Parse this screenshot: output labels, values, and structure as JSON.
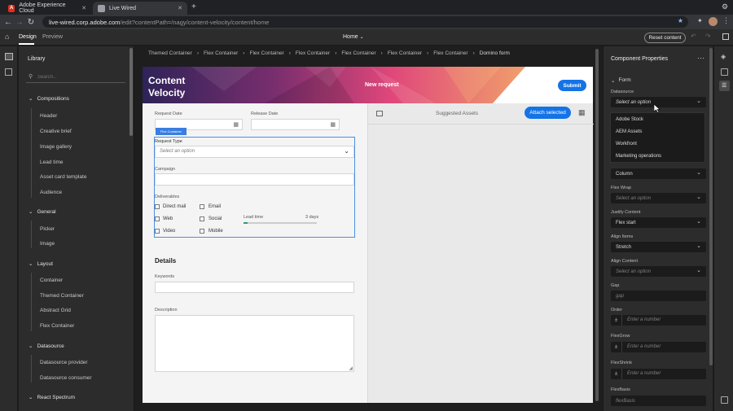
{
  "browser": {
    "tabs": [
      {
        "title": "Adobe Experience Cloud",
        "icon": "adobe-icon",
        "color": "#e52c1d"
      },
      {
        "title": "Live Wired",
        "icon": "page-icon",
        "color": "#9aa0a6"
      }
    ],
    "url_host": "live-wired.corp.adobe.com",
    "url_path": "/edit?contentPath=/nagy/content-velocity/content/home"
  },
  "app": {
    "mode_tabs": [
      "Design",
      "Preview"
    ],
    "page_selector": "Home",
    "reset_button": "Reset content"
  },
  "library": {
    "title": "Library",
    "search_placeholder": "Search...",
    "sections": [
      {
        "name": "Compositions",
        "items": [
          "Header",
          "Creative brief",
          "Image gallery",
          "Lead time",
          "Asset card template",
          "Audience"
        ]
      },
      {
        "name": "General",
        "items": [
          "Picker",
          "Image"
        ]
      },
      {
        "name": "Layout",
        "items": [
          "Container",
          "Themed Container",
          "Abstract Grid",
          "Flex Container"
        ]
      },
      {
        "name": "Datasource",
        "items": [
          "Datasource provider",
          "Datasource consumer"
        ]
      },
      {
        "name": "React Spectrum",
        "items": []
      }
    ]
  },
  "breadcrumbs": [
    "Themed Container",
    "Flex Container",
    "Flex Container",
    "Flex Container",
    "Flex Container",
    "Flex Container",
    "Flex Container",
    "Domino form"
  ],
  "form": {
    "brand_line1": "Content",
    "brand_line2": "Velocity",
    "banner_title": "New request",
    "submit": "Submit",
    "selection_tag": "Flex Container",
    "request_date_label": "Request Date",
    "release_date_label": "Release Date",
    "request_type_label": "Request Type",
    "request_type_placeholder": "Select an option",
    "campaign_label": "Campaign",
    "deliverables_label": "Deliverables",
    "checkboxes_col1": [
      "Direct mail",
      "Web",
      "Video"
    ],
    "checkboxes_col2": [
      "Email",
      "Social",
      "Mobile"
    ],
    "lead_time_label": "Lead time",
    "lead_time_value": "3 days",
    "lead_time_progress": 0.06,
    "details_heading": "Details",
    "keywords_label": "Keywords",
    "description_label": "Description",
    "suggested_assets": "Suggested Assets",
    "attach_selected": "Attach selected"
  },
  "props": {
    "title": "Component Properties",
    "section": "Form",
    "datasource_label": "Datasource",
    "datasource_placeholder": "Select an option",
    "datasource_options": [
      "Adobe Stock",
      "AEM Assets",
      "Workfront",
      "Marketing operations"
    ],
    "flex_direction_value": "Column",
    "flex_wrap_label": "Flex Wrap",
    "flex_wrap_placeholder": "Select an option",
    "justify_label": "Justify Content",
    "justify_value": "Flex start",
    "align_items_label": "Align Items",
    "align_items_value": "Stretch",
    "align_content_label": "Align Content",
    "align_content_placeholder": "Select an option",
    "gap_label": "Gap",
    "gap_placeholder": "gap",
    "order_label": "Order",
    "order_placeholder": "Enter a number",
    "flexgrow_label": "FlexGrow",
    "flexgrow_placeholder": "Enter a number",
    "flexshrink_label": "FlexShrink",
    "flexshrink_placeholder": "Enter a number",
    "flexbasis_label": "FlexBasis",
    "flexbasis_placeholder": "flexBasis"
  },
  "colors": {
    "accent": "#1473e6",
    "selection": "#4a90e2",
    "progress": "#2d9d78"
  }
}
